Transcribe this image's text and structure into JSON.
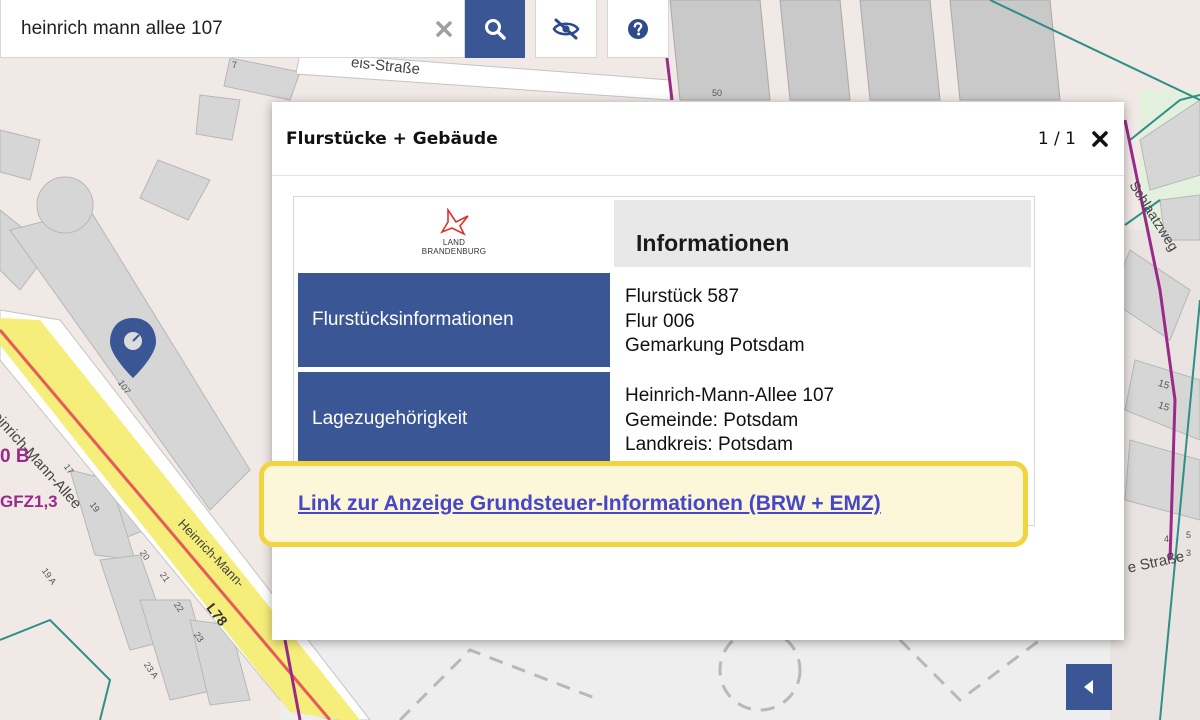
{
  "search": {
    "value": "heinrich mann allee 107",
    "clear_icon": "close-icon",
    "search_icon": "search-icon",
    "visibility_icon": "eye-slash-icon",
    "help_icon": "question-circle-icon"
  },
  "popup": {
    "title": "Flurstücke + Gebäude",
    "counter": "1 / 1",
    "close_icon": "close-icon",
    "logo": {
      "line1": "LAND",
      "line2": "BRANDENBURG"
    },
    "heading": "Informationen",
    "rows": [
      {
        "label": "Flurstücksinformationen",
        "values": [
          "Flurstück 587",
          "Flur 006",
          "Gemarkung Potsdam"
        ]
      },
      {
        "label": "Lagezugehörigkeit",
        "values": [
          "Heinrich-Mann-Allee 107",
          "Gemeinde: Potsdam",
          "Landkreis: Potsdam"
        ]
      }
    ],
    "link_text": "Link zur Anzeige Grundsteuer-Informationen (BRW + EMZ)"
  },
  "map": {
    "street_labels": [
      "Heinrich-Mann-Allee",
      "Heinrich-Mann-",
      "Schlaatzweg",
      "e Straße",
      "eis-Straße"
    ],
    "road_number": "L78",
    "zone_labels": [
      "0 B",
      "GFZ1,3"
    ],
    "house_numbers": [
      "107",
      "15",
      "15",
      "17",
      "19",
      "19 A",
      "20",
      "21",
      "22",
      "23",
      "23 A",
      "50",
      "7",
      "4",
      "5",
      "3"
    ],
    "marker_icon": "map-marker-icon",
    "colors": {
      "primary": "#3a5695",
      "highlight_border": "#f0d540",
      "link": "#4646c8",
      "road_yellow": "#f6ee7a",
      "road_red": "#e85a5a",
      "boundary_purple": "#9a2a8a",
      "boundary_teal": "#2f8f86"
    }
  },
  "controls": {
    "collapse_icon": "caret-left-icon"
  }
}
